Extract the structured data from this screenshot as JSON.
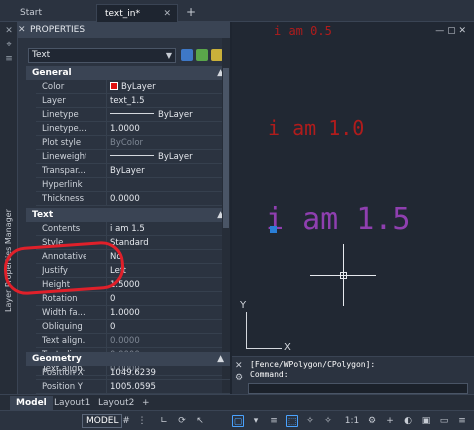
{
  "tabs": {
    "start_label": "Start",
    "active_label": "text_in*",
    "close_glyph": "✕",
    "add_glyph": "+"
  },
  "side_panel": {
    "vertical_label": "Layer Properties Manager"
  },
  "palette": {
    "title": "PROPERTIES",
    "selector_value": "Text",
    "general": {
      "header": "General",
      "rows": [
        {
          "key": "Color",
          "value": "ByLayer"
        },
        {
          "key": "Layer",
          "value": "text_1.5"
        },
        {
          "key": "Linetype",
          "value": "ByLayer"
        },
        {
          "key": "Linetype...",
          "value": "1.0000"
        },
        {
          "key": "Plot style",
          "value": "ByColor"
        },
        {
          "key": "Lineweight",
          "value": "ByLayer"
        },
        {
          "key": "Transpar...",
          "value": "ByLayer"
        },
        {
          "key": "Hyperlink",
          "value": ""
        },
        {
          "key": "Thickness",
          "value": "0.0000"
        }
      ]
    },
    "text": {
      "header": "Text",
      "rows": [
        {
          "key": "Contents",
          "value": "i am 1.5"
        },
        {
          "key": "Style",
          "value": "Standard"
        },
        {
          "key": "Annotative",
          "value": "No"
        },
        {
          "key": "Justify",
          "value": "Left"
        },
        {
          "key": "Height",
          "value": "1.5000"
        },
        {
          "key": "Rotation",
          "value": "0"
        },
        {
          "key": "Width fa...",
          "value": "1.0000"
        },
        {
          "key": "Obliquing",
          "value": "0"
        },
        {
          "key": "Text align...",
          "value": "0.0000"
        },
        {
          "key": "Text align...",
          "value": "0.0000"
        },
        {
          "key": "Text align...",
          "value": "0.0000"
        }
      ]
    },
    "geometry": {
      "header": "Geometry",
      "rows": [
        {
          "key": "Position X",
          "value": "1049.6239"
        },
        {
          "key": "Position Y",
          "value": "1005.0595"
        }
      ]
    }
  },
  "drawing": {
    "text_small": "i am 0.5",
    "text_medium": "i am 1.0",
    "text_large": "i am 1.5",
    "ucs_y": "Y",
    "ucs_x": "X",
    "viewport_controls": "— ▢ ✕"
  },
  "command": {
    "line1": "[Fence/WPolygon/CPolygon]:",
    "line2": "Command:"
  },
  "layout_tabs": [
    "Model",
    "Layout1",
    "Layout2",
    "+"
  ],
  "status": {
    "model_label": "MODEL",
    "scale_label": "1:1"
  },
  "colors": {
    "red_text": "#b01c1c",
    "purple_text": "#8f3fb0",
    "annotation": "#e0202a",
    "accent": "#4aa3ff"
  }
}
